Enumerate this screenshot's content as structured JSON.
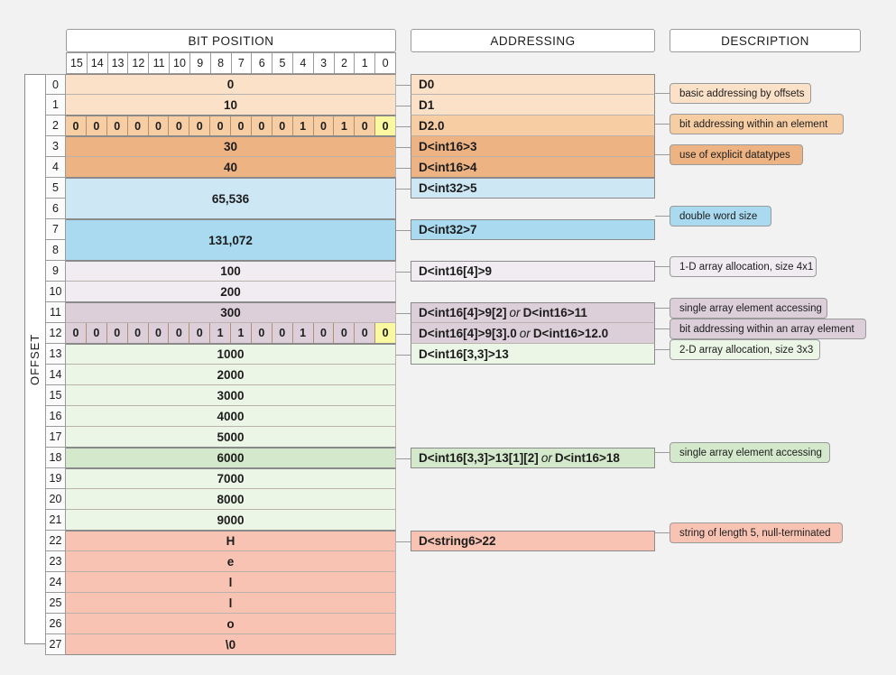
{
  "headers": {
    "bit_position": "BIT POSITION",
    "addressing": "ADDRESSING",
    "description": "DESCRIPTION",
    "offset": "OFFSET"
  },
  "bit_numbers": [
    "15",
    "14",
    "13",
    "12",
    "11",
    "10",
    "9",
    "8",
    "7",
    "6",
    "5",
    "4",
    "3",
    "2",
    "1",
    "0"
  ],
  "colors": {
    "orange_light": "#fbe1c8",
    "orange_mid": "#f7cda4",
    "orange_dark": "#eeb382",
    "blue_light": "#cde7f5",
    "blue_dark": "#a9daf0",
    "purple_light": "#f1ecf1",
    "purple_dark": "#dccfd9",
    "green_light": "#ecf6e7",
    "green_dark": "#d4e8cb",
    "red": "#f9c3b4",
    "highlight": "#faf8a0",
    "page_bg": "#f2f2f2"
  },
  "rows": [
    {
      "offset": "0",
      "value": "0"
    },
    {
      "offset": "1",
      "value": "10"
    },
    {
      "offset": "2",
      "value": "",
      "bits": [
        "0",
        "0",
        "0",
        "0",
        "0",
        "0",
        "0",
        "0",
        "0",
        "0",
        "0",
        "1",
        "0",
        "1",
        "0",
        "0"
      ],
      "highlight_bit": 15
    },
    {
      "offset": "3",
      "value": "30"
    },
    {
      "offset": "4",
      "value": "40"
    },
    {
      "offset": "5",
      "value": "65,536"
    },
    {
      "offset": "6",
      "value": ""
    },
    {
      "offset": "7",
      "value": "131,072"
    },
    {
      "offset": "8",
      "value": ""
    },
    {
      "offset": "9",
      "value": "100"
    },
    {
      "offset": "10",
      "value": "200"
    },
    {
      "offset": "11",
      "value": "300"
    },
    {
      "offset": "12",
      "value": "",
      "bits": [
        "0",
        "0",
        "0",
        "0",
        "0",
        "0",
        "0",
        "1",
        "1",
        "0",
        "0",
        "1",
        "0",
        "0",
        "0",
        "0"
      ],
      "highlight_bit": 15
    },
    {
      "offset": "13",
      "value": "1000"
    },
    {
      "offset": "14",
      "value": "2000"
    },
    {
      "offset": "15",
      "value": "3000"
    },
    {
      "offset": "16",
      "value": "4000"
    },
    {
      "offset": "17",
      "value": "5000"
    },
    {
      "offset": "18",
      "value": "6000"
    },
    {
      "offset": "19",
      "value": "7000"
    },
    {
      "offset": "20",
      "value": "8000"
    },
    {
      "offset": "21",
      "value": "9000"
    },
    {
      "offset": "22",
      "value": "H"
    },
    {
      "offset": "23",
      "value": "e"
    },
    {
      "offset": "24",
      "value": "l"
    },
    {
      "offset": "25",
      "value": "l"
    },
    {
      "offset": "26",
      "value": "o"
    },
    {
      "offset": "27",
      "value": "\\0"
    }
  ],
  "addressing": [
    {
      "label": "D0"
    },
    {
      "label": "D1"
    },
    {
      "label": "D2.0"
    },
    {
      "label": "D<int16>3"
    },
    {
      "label": "D<int16>4"
    },
    {
      "label": "D<int32>5"
    },
    {
      "label": "D<int32>7"
    },
    {
      "label": "D<int16[4]>9"
    },
    {
      "pre": "D<int16[4]>9[2]",
      "it": "or",
      "post": "D<int16>11"
    },
    {
      "pre": "D<int16[4]>9[3].0",
      "it": "or",
      "post": "D<int16>12.0"
    },
    {
      "label": "D<int16[3,3]>13"
    },
    {
      "pre": "D<int16[3,3]>13[1][2]",
      "it": "or",
      "post": "D<int16>18"
    },
    {
      "label": "D<string6>22"
    }
  ],
  "descriptions": [
    {
      "text": "basic addressing by offsets"
    },
    {
      "text": "bit addressing within an element"
    },
    {
      "text": "use of explicit datatypes"
    },
    {
      "text": "double word size"
    },
    {
      "text": "1-D array allocation, size 4x1"
    },
    {
      "text": "single array element accessing"
    },
    {
      "text": "bit addressing within an array element"
    },
    {
      "text": "2-D array allocation, size 3x3"
    },
    {
      "text": "single array element accessing"
    },
    {
      "text": "string of length 5, null-terminated"
    }
  ]
}
